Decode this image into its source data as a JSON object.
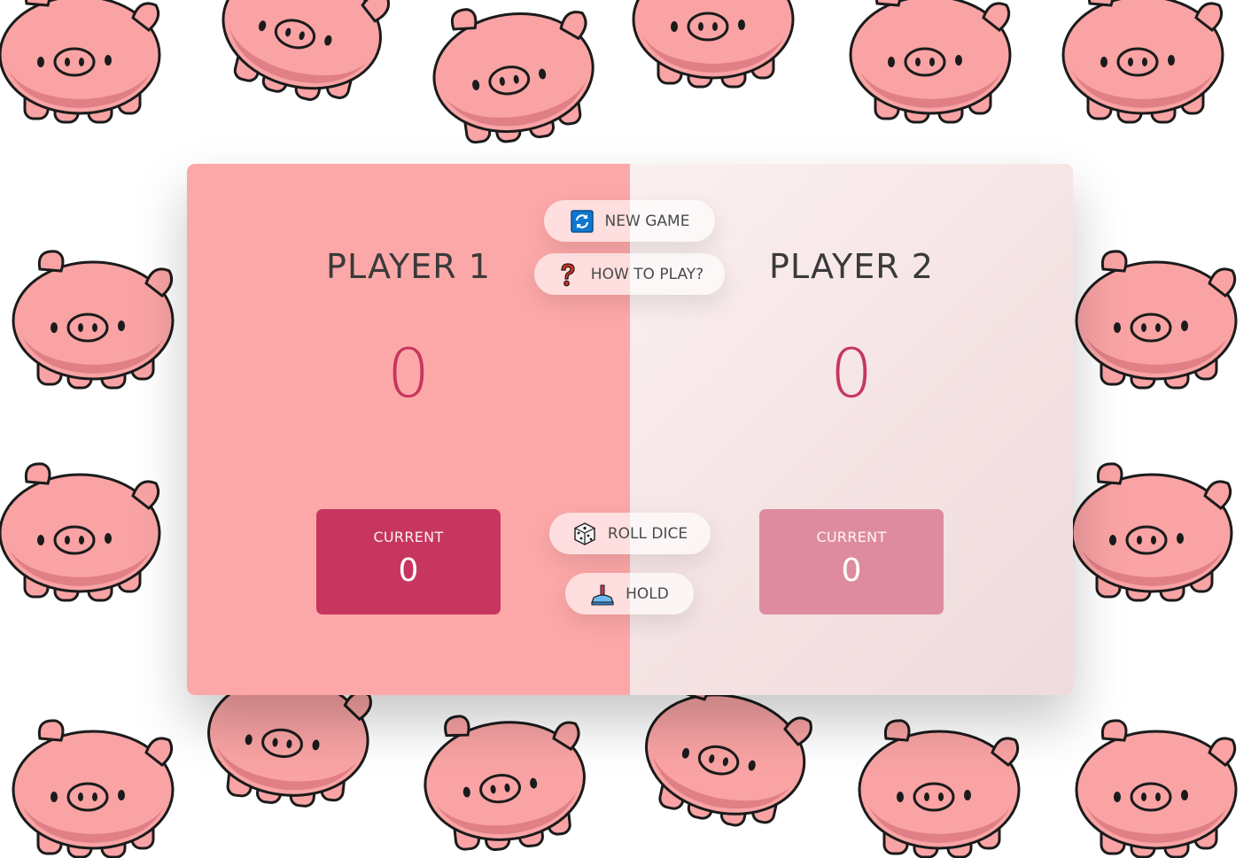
{
  "players": [
    {
      "name": "PLAYER 1",
      "score": "0",
      "current_label": "CURRENT",
      "current_score": "0",
      "active": true
    },
    {
      "name": "PLAYER 2",
      "score": "0",
      "current_label": "CURRENT",
      "current_score": "0",
      "active": false
    }
  ],
  "buttons": {
    "new_game": {
      "label": "NEW GAME",
      "icon": "refresh-icon"
    },
    "how_to_play": {
      "label": "HOW TO PLAY?",
      "icon": "question-mark-icon"
    },
    "roll_dice": {
      "label": "ROLL DICE",
      "icon": "dice-icon"
    },
    "hold": {
      "label": "HOLD",
      "icon": "hold-lever-icon"
    }
  },
  "colors": {
    "active_panel": "#fda8a8",
    "inactive_panel": "#f5e3e4",
    "accent": "#c7365f",
    "inactive_current": "#df8b9f",
    "pig": "#f9a3a4"
  },
  "background": {
    "pattern_icon": "pig-icon"
  }
}
